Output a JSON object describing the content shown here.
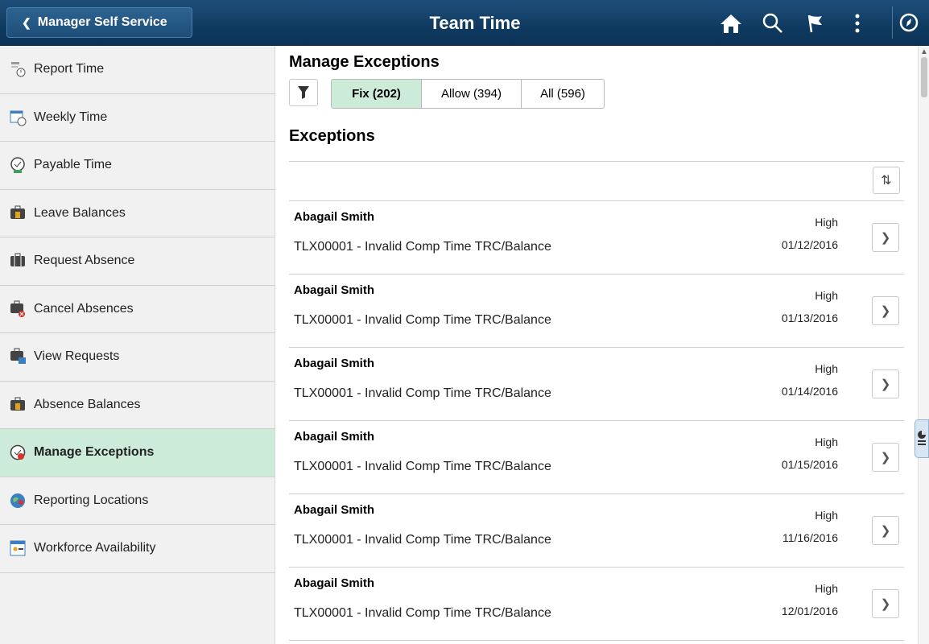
{
  "header": {
    "back_label": "Manager Self Service",
    "title": "Team Time",
    "icons": [
      "home-icon",
      "search-icon",
      "flag-icon",
      "more-icon",
      "navbar-icon"
    ]
  },
  "sidebar": {
    "items": [
      {
        "label": "Report Time",
        "icon": "report-time-icon"
      },
      {
        "label": "Weekly Time",
        "icon": "weekly-time-icon"
      },
      {
        "label": "Payable Time",
        "icon": "payable-time-icon"
      },
      {
        "label": "Leave Balances",
        "icon": "leave-balances-icon"
      },
      {
        "label": "Request Absence",
        "icon": "request-absence-icon"
      },
      {
        "label": "Cancel Absences",
        "icon": "cancel-absences-icon"
      },
      {
        "label": "View Requests",
        "icon": "view-requests-icon"
      },
      {
        "label": "Absence Balances",
        "icon": "absence-balances-icon"
      },
      {
        "label": "Manage Exceptions",
        "icon": "manage-exceptions-icon"
      },
      {
        "label": "Reporting Locations",
        "icon": "reporting-locations-icon"
      },
      {
        "label": "Workforce Availability",
        "icon": "workforce-availability-icon"
      }
    ],
    "active_index": 8
  },
  "main": {
    "title": "Manage Exceptions",
    "tabs": [
      {
        "label": "Fix (202)",
        "selected": true
      },
      {
        "label": "Allow (394)",
        "selected": false
      },
      {
        "label": "All (596)",
        "selected": false
      }
    ],
    "section_title": "Exceptions",
    "rows": [
      {
        "name": "Abagail Smith",
        "description": "TLX00001 - Invalid Comp Time TRC/Balance",
        "severity": "High",
        "date": "01/12/2016"
      },
      {
        "name": "Abagail Smith",
        "description": "TLX00001 - Invalid Comp Time TRC/Balance",
        "severity": "High",
        "date": "01/13/2016"
      },
      {
        "name": "Abagail Smith",
        "description": "TLX00001 - Invalid Comp Time TRC/Balance",
        "severity": "High",
        "date": "01/14/2016"
      },
      {
        "name": "Abagail Smith",
        "description": "TLX00001 - Invalid Comp Time TRC/Balance",
        "severity": "High",
        "date": "01/15/2016"
      },
      {
        "name": "Abagail Smith",
        "description": "TLX00001 - Invalid Comp Time TRC/Balance",
        "severity": "High",
        "date": "11/16/2016"
      },
      {
        "name": "Abagail Smith",
        "description": "TLX00001 - Invalid Comp Time TRC/Balance",
        "severity": "High",
        "date": "12/01/2016"
      }
    ]
  },
  "colors": {
    "header_bg": "#0f3a60",
    "active_bg": "#cdebd9",
    "sidebar_bg": "#f1f1f1"
  }
}
